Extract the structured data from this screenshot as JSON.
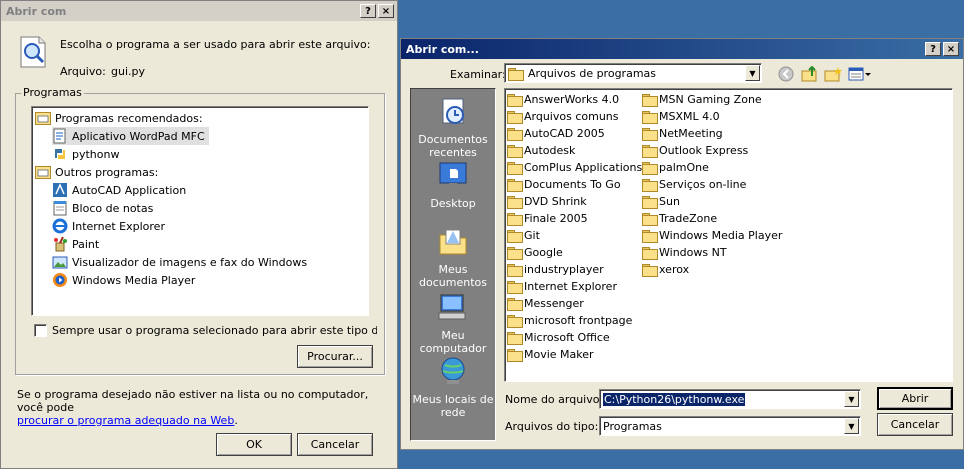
{
  "left_dialog": {
    "title": "Abrir com",
    "question": "Escolha o programa a ser usado para abrir este arquivo:",
    "file_label": "Arquivo:",
    "file_name": "gui.py",
    "group_label": "Programas",
    "recommended_header": "Programas recomendados:",
    "recommended": [
      "Aplicativo WordPad MFC",
      "pythonw"
    ],
    "other_header": "Outros programas:",
    "others": [
      "AutoCAD Application",
      "Bloco de notas",
      "Internet Explorer",
      "Paint",
      "Visualizador de imagens e fax do Windows",
      "Windows Media Player"
    ],
    "always_use": "Sempre usar o programa selecionado para abrir este tipo de arquivo",
    "browse_button": "Procurar...",
    "footer_text": "Se o programa desejado não estiver na lista ou no computador, você pode",
    "footer_link": "procurar o programa adequado na Web",
    "footer_end": ".",
    "ok_button": "OK",
    "cancel_button": "Cancelar",
    "help_btn": "?",
    "close_btn": "×"
  },
  "right_dialog": {
    "title": "Abrir com...",
    "lookin_label": "Examinar:",
    "lookin_value": "Arquivos de programas",
    "places": [
      "Documentos recentes",
      "Desktop",
      "Meus documentos",
      "Meu computador",
      "Meus locais de rede"
    ],
    "folders_col1": [
      "AnswerWorks 4.0",
      "Arquivos comuns",
      "AutoCAD 2005",
      "Autodesk",
      "ComPlus Applications",
      "Documents To Go",
      "DVD Shrink",
      "Finale 2005",
      "Git",
      "Google",
      "industryplayer",
      "Internet Explorer",
      "Messenger",
      "microsoft frontpage",
      "Microsoft Office",
      "Movie Maker"
    ],
    "folders_col2": [
      "MSN Gaming Zone",
      "MSXML 4.0",
      "NetMeeting",
      "Outlook Express",
      "palmOne",
      "Serviços on-line",
      "Sun",
      "TradeZone",
      "Windows Media Player",
      "Windows NT",
      "xerox"
    ],
    "filename_label": "Nome do arquivo:",
    "filename_value": "C:\\Python26\\pythonw.exe",
    "filetype_label": "Arquivos do tipo:",
    "filetype_value": "Programas",
    "open_button": "Abrir",
    "cancel_button": "Cancelar",
    "help_btn": "?",
    "close_btn": "×"
  }
}
